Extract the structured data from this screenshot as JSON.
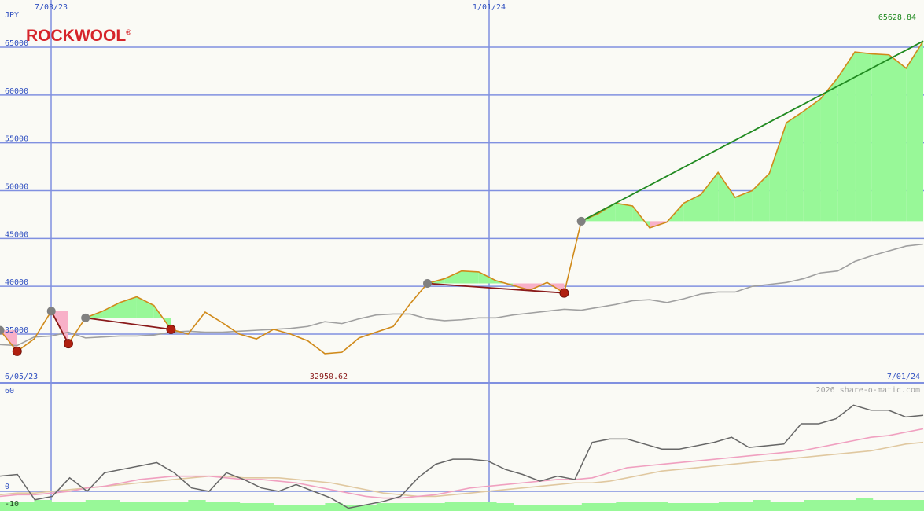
{
  "colors": {
    "background": "#fafaf5",
    "grid": "#8090e0",
    "axis_label": "#3050c0",
    "price_line": "#d08a1a",
    "average_line": "#a0a0a0",
    "gain_fill": "#98f898",
    "loss_fill": "#f8b0c8",
    "uptrend_line": "#208a20",
    "downtrend_line": "#8a1a1a",
    "max_label": "#208a20",
    "min_label": "#8a1a1a",
    "logo": "#d6242a",
    "watermark": "#a0a0a0",
    "osc_main": "#666666",
    "osc_pink": "#f0a0c0",
    "osc_tan": "#e0c8a0",
    "volume": "#98f898"
  },
  "logo": {
    "text": "ROCKWOOL",
    "mark": "®"
  },
  "watermark": "2026 share-o-matic.com",
  "chart_data": [
    {
      "type": "line",
      "currency_label": "JPY",
      "y_ticks": [
        "65000",
        "60000",
        "55000",
        "50000",
        "45000",
        "40000",
        "35000"
      ],
      "ylim": [
        30000,
        65500
      ],
      "x_top_labels": [
        "7/03/23",
        "1/01/24"
      ],
      "x_bottom_labels": [
        "6/05/23",
        "7/01/24"
      ],
      "date_range": [
        "6/05/23",
        "7/01/24"
      ],
      "max_label": "65628.84",
      "min_label": "32950.62",
      "series": [
        {
          "values": [
            35400,
            33200,
            34500,
            37400,
            34000,
            36700,
            37400,
            38300,
            38900,
            38000,
            35500,
            35000,
            37300,
            36200,
            35000,
            34500,
            35500,
            35000,
            34300,
            32950,
            33100,
            34600,
            35200,
            35800,
            38200,
            40300,
            40800,
            41600,
            41500,
            40600,
            40100,
            39600,
            40400,
            39300,
            46800,
            47600,
            48700,
            48400,
            46100,
            46700,
            48700,
            49600,
            51900,
            49300,
            50000,
            51800,
            57100,
            58300,
            59600,
            61800,
            64500,
            64300,
            64200,
            62800,
            65628.84
          ]
        },
        {
          "values": [
            33900,
            33800,
            34700,
            34800,
            35200,
            34600,
            34700,
            34800,
            34800,
            34900,
            35200,
            35300,
            35200,
            35200,
            35300,
            35400,
            35500,
            35600,
            35800,
            36300,
            36100,
            36600,
            37000,
            37100,
            37100,
            36600,
            36400,
            36500,
            36700,
            36700,
            37000,
            37200,
            37400,
            37600,
            37500,
            37800,
            38100,
            38500,
            38600,
            38300,
            38700,
            39200,
            39400,
            39400,
            40000,
            40200,
            40400,
            40800,
            41400,
            41600,
            42600,
            43200,
            43700,
            44200,
            44400
          ]
        }
      ]
    },
    {
      "type": "line",
      "y_ticks": [
        "60",
        "0",
        "-10"
      ],
      "ylim": [
        -14,
        64
      ],
      "series": [
        {
          "values": [
            9,
            10,
            -5,
            -3,
            8,
            0,
            11,
            13,
            15,
            17,
            11,
            2,
            0,
            11,
            7,
            2,
            0,
            4,
            0,
            -4,
            -10,
            -8,
            -6,
            -3,
            8,
            16,
            19,
            19,
            18,
            13,
            10,
            6,
            9,
            7,
            29,
            31,
            31,
            28,
            25,
            25,
            27,
            29,
            32,
            26,
            27,
            28,
            40,
            40,
            43,
            51,
            48,
            48,
            44,
            45
          ]
        },
        {
          "values": [
            -3,
            -2,
            -2,
            -1,
            0,
            2,
            3,
            5,
            7,
            8,
            9,
            9,
            9,
            8,
            7,
            7,
            6,
            5,
            3,
            1,
            -1,
            -3,
            -4,
            -4,
            -3,
            -2,
            0,
            2,
            3,
            4,
            5,
            6,
            7,
            7,
            8,
            11,
            14,
            15,
            16,
            17,
            18,
            19,
            20,
            21,
            22,
            23,
            24,
            26,
            28,
            30,
            32,
            33,
            35,
            37
          ]
        },
        {
          "values": [
            -2,
            -1,
            -1,
            0,
            1,
            2,
            3,
            4,
            5,
            6,
            7,
            8,
            9,
            9,
            8,
            8,
            8,
            7,
            6,
            5,
            3,
            1,
            -1,
            -2,
            -3,
            -3,
            -2,
            -1,
            0,
            1,
            2,
            3,
            4,
            5,
            5,
            6,
            8,
            10,
            12,
            13,
            14,
            15,
            16,
            17,
            18,
            19,
            20,
            21,
            22,
            23,
            24,
            26,
            28,
            29
          ]
        },
        {
          "type": "bar",
          "values": [
            6,
            6,
            7,
            6,
            6,
            7,
            7,
            6,
            6,
            6,
            6,
            7,
            6,
            6,
            5,
            5,
            4,
            4,
            4,
            5,
            4,
            4,
            5,
            5,
            5,
            5,
            6,
            6,
            6,
            5,
            4,
            4,
            4,
            4,
            5,
            5,
            6,
            6,
            6,
            5,
            5,
            5,
            6,
            6,
            7,
            6,
            6,
            7,
            7,
            7,
            8,
            7,
            7,
            7
          ]
        }
      ]
    }
  ]
}
